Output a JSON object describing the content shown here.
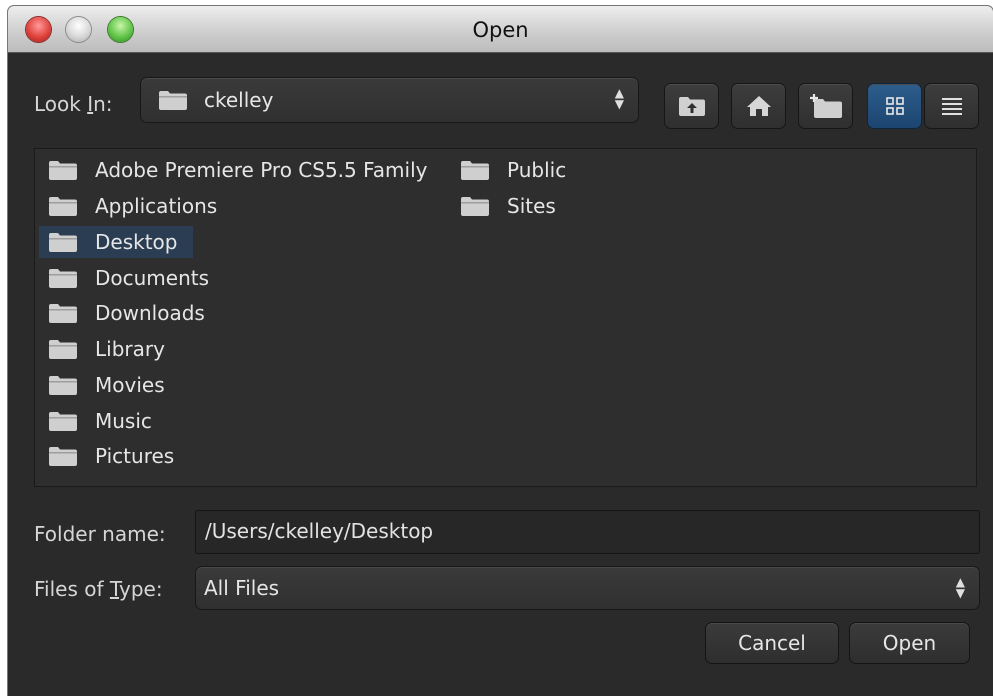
{
  "window": {
    "title": "Open"
  },
  "look_in": {
    "label_pre": "Look ",
    "label_ul": "I",
    "label_post": "n:",
    "value": "ckelley",
    "icon": "folder-icon"
  },
  "toolbar": {
    "buttons": [
      {
        "name": "up-one-level-button",
        "icon": "folder-up-icon"
      },
      {
        "name": "home-button",
        "icon": "home-icon"
      },
      {
        "name": "new-folder-button",
        "icon": "new-folder-icon"
      },
      {
        "name": "list-view-button",
        "icon": "grid-icon",
        "active": true
      },
      {
        "name": "details-view-button",
        "icon": "list-icon",
        "active": false
      }
    ]
  },
  "files": {
    "column1": [
      "Adobe Premiere Pro CS5.5 Family",
      "Applications",
      "Desktop",
      "Documents",
      "Downloads",
      "Library",
      "Movies",
      "Music",
      "Pictures"
    ],
    "column2": [
      "Public",
      "Sites"
    ],
    "selected": "Desktop"
  },
  "folder_name": {
    "label": "Folder name:",
    "value": "/Users/ckelley/Desktop"
  },
  "files_of_type": {
    "label_pre": "Files of ",
    "label_ul": "T",
    "label_post": "ype:",
    "value": "All Files"
  },
  "buttons": {
    "cancel": "Cancel",
    "open": "Open"
  },
  "colors": {
    "window_bg": "#2a2a2a",
    "selection": "#2b3d52",
    "active_toggle": "#2d5d8c"
  }
}
